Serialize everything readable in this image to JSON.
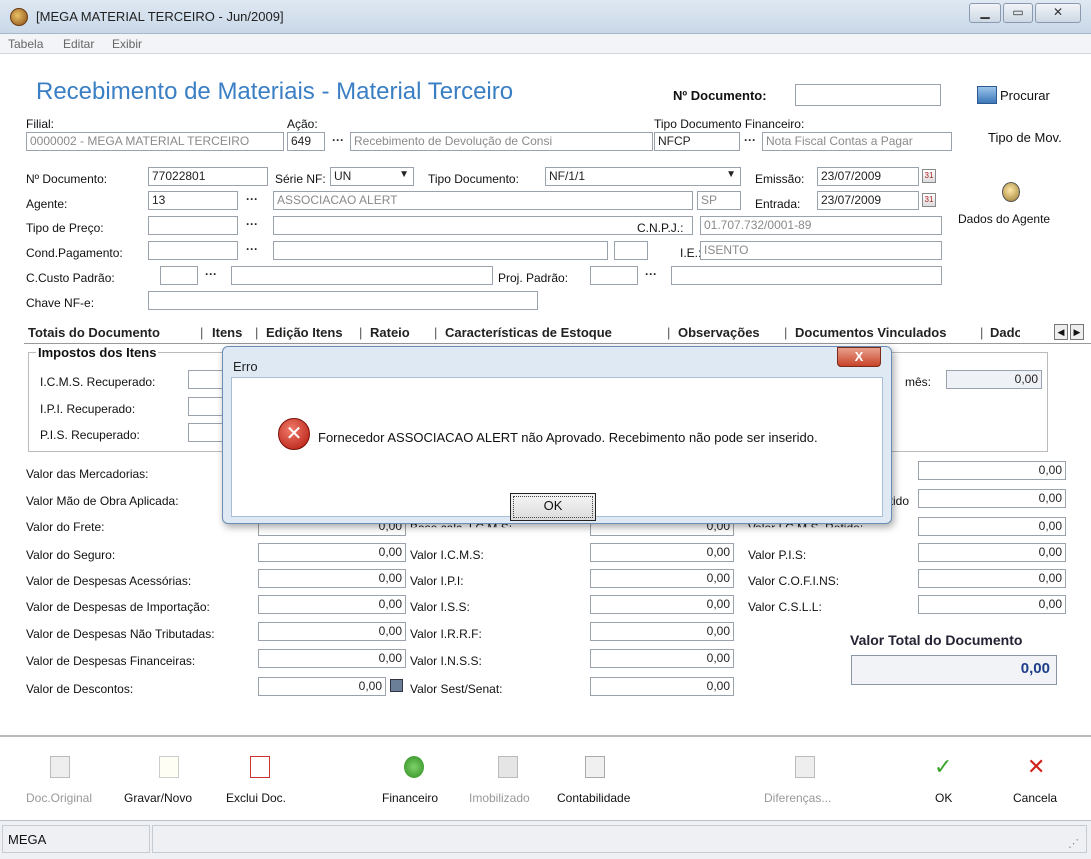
{
  "window": {
    "title": "[MEGA MATERIAL TERCEIRO - Jun/2009]"
  },
  "menu": [
    "Tabela",
    "Editar",
    "Exibir"
  ],
  "header": {
    "form_title": "Recebimento de Materiais - Material Terceiro",
    "doc_label": "Nº Documento:",
    "doc_value": "",
    "search_label": "Procurar"
  },
  "top_fields": {
    "filial_label": "Filial:",
    "filial_value": "0000002 - MEGA MATERIAL TERCEIRO",
    "acao_label": "Ação:",
    "acao_code": "649",
    "acao_desc": "Recebimento de Devolução de Consi",
    "tipo_fin_label": "Tipo Documento Financeiro:",
    "tipo_fin_code": "NFCP",
    "tipo_fin_desc": "Nota Fiscal Contas a Pagar",
    "tipo_mov_label": "Tipo de Mov."
  },
  "doc_fields": {
    "num_doc_label": "Nº Documento:",
    "num_doc_value": "77022801",
    "serie_label": "Série NF:",
    "serie_value": "UN",
    "tipo_doc_label": "Tipo Documento:",
    "tipo_doc_value": "NF/1/1",
    "emissao_label": "Emissão:",
    "emissao_value": "23/07/2009",
    "agente_label": "Agente:",
    "agente_code": "13",
    "agente_name": "ASSOCIACAO ALERT",
    "agente_uf": "SP",
    "entrada_label": "Entrada:",
    "entrada_value": "23/07/2009",
    "dados_agente_label": "Dados do Agente",
    "tipo_preco_label": "Tipo de Preço:",
    "cnpj_label": "C.N.P.J.:",
    "cnpj_value": "01.707.732/0001-89",
    "cond_pag_label": "Cond.Pagamento:",
    "ie_label": "I.E.:",
    "ie_value": "ISENTO",
    "ccusto_label": "C.Custo Padrão:",
    "proj_label": "Proj. Padrão:",
    "chave_label": "Chave NF-e:"
  },
  "tabs": [
    "Totais do Documento",
    "Itens",
    "Edição Itens",
    "Rateio",
    "Características de Estoque",
    "Observações",
    "Documentos Vinculados",
    "Dados"
  ],
  "impostos": {
    "title": "Impostos dos Itens",
    "icms_label": "I.C.M.S. Recuperado:",
    "ipi_label": "I.P.I. Recuperado:",
    "pis_label": "P.I.S. Recuperado:",
    "mes_label": "mês:",
    "mes_value": "0,00"
  },
  "col1": [
    {
      "label": "Valor das Mercadorias:",
      "value": ""
    },
    {
      "label": "Valor Mão de Obra Aplicada:",
      "value": ""
    },
    {
      "label": "Valor do Frete:",
      "value": "0,00"
    },
    {
      "label": "Valor do Seguro:",
      "value": "0,00"
    },
    {
      "label": "Valor de Despesas Acessórias:",
      "value": "0,00"
    },
    {
      "label": "Valor de Despesas de Importação:",
      "value": "0,00"
    },
    {
      "label": "Valor de Despesas Não Tributadas:",
      "value": "0,00"
    },
    {
      "label": "Valor de Despesas Financeiras:",
      "value": "0,00"
    },
    {
      "label": "Valor de Descontos:",
      "value": "0,00"
    }
  ],
  "col2": [
    {
      "label": "Base calc. I.C.M.S:",
      "value": "0,00"
    },
    {
      "label": "Valor I.C.M.S:",
      "value": "0,00"
    },
    {
      "label": "Valor I.P.I:",
      "value": "0,00"
    },
    {
      "label": "Valor I.S.S:",
      "value": "0,00"
    },
    {
      "label": "Valor I.R.R.F:",
      "value": "0,00"
    },
    {
      "label": "Valor I.N.S.S:",
      "value": "0,00"
    },
    {
      "label": "Valor Sest/Senat:",
      "value": "0,00"
    }
  ],
  "col3": [
    {
      "label": "",
      "value": "0,00"
    },
    {
      "label": "etido",
      "value": "0,00"
    },
    {
      "label": "Valor I.C.M.S. Retido:",
      "value": "0,00"
    },
    {
      "label": "Valor P.I.S:",
      "value": "0,00"
    },
    {
      "label": "Valor C.O.F.I.NS:",
      "value": "0,00"
    },
    {
      "label": "Valor C.S.L.L:",
      "value": "0,00"
    }
  ],
  "total": {
    "label": "Valor Total do Documento",
    "value": "0,00"
  },
  "toolbar": {
    "doc_original": "Doc.Original",
    "gravar_novo": "Gravar/Novo",
    "exclui_doc": "Exclui Doc.",
    "financeiro": "Financeiro",
    "imobilizado": "Imobilizado",
    "contabilidade": "Contabilidade",
    "diferencas": "Diferenças...",
    "ok": "OK",
    "cancela": "Cancela"
  },
  "status": {
    "text": "MEGA"
  },
  "dialog": {
    "title": "Erro",
    "message": "Fornecedor ASSOCIACAO ALERT não Aprovado. Recebimento não pode ser inserido.",
    "ok": "OK"
  }
}
